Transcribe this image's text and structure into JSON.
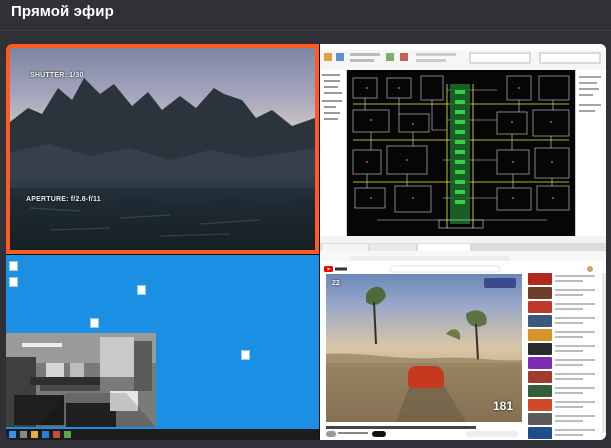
{
  "header": {
    "title": "Прямой эфир"
  },
  "tiles": {
    "video": {
      "osd_top": "SHUTTER: 1/30",
      "osd_bottom": "APERTURE: f/2.8-f/11",
      "border_color": "#ff5a1f"
    },
    "cad": {
      "status_left": "",
      "icon": "cad-schematic-icon"
    },
    "desktop": {
      "background_color": "#1a8fe3",
      "taskbar_clock": "",
      "icon": "desktop-icon"
    },
    "youtube": {
      "player_gear": "22",
      "player_speed": "181",
      "video_title": "",
      "icon": "youtube-logo-icon"
    }
  },
  "colors": {
    "page_bg": "#2f3136",
    "accent": "#ff5a1f",
    "desktop_blue": "#1a8fe3"
  }
}
